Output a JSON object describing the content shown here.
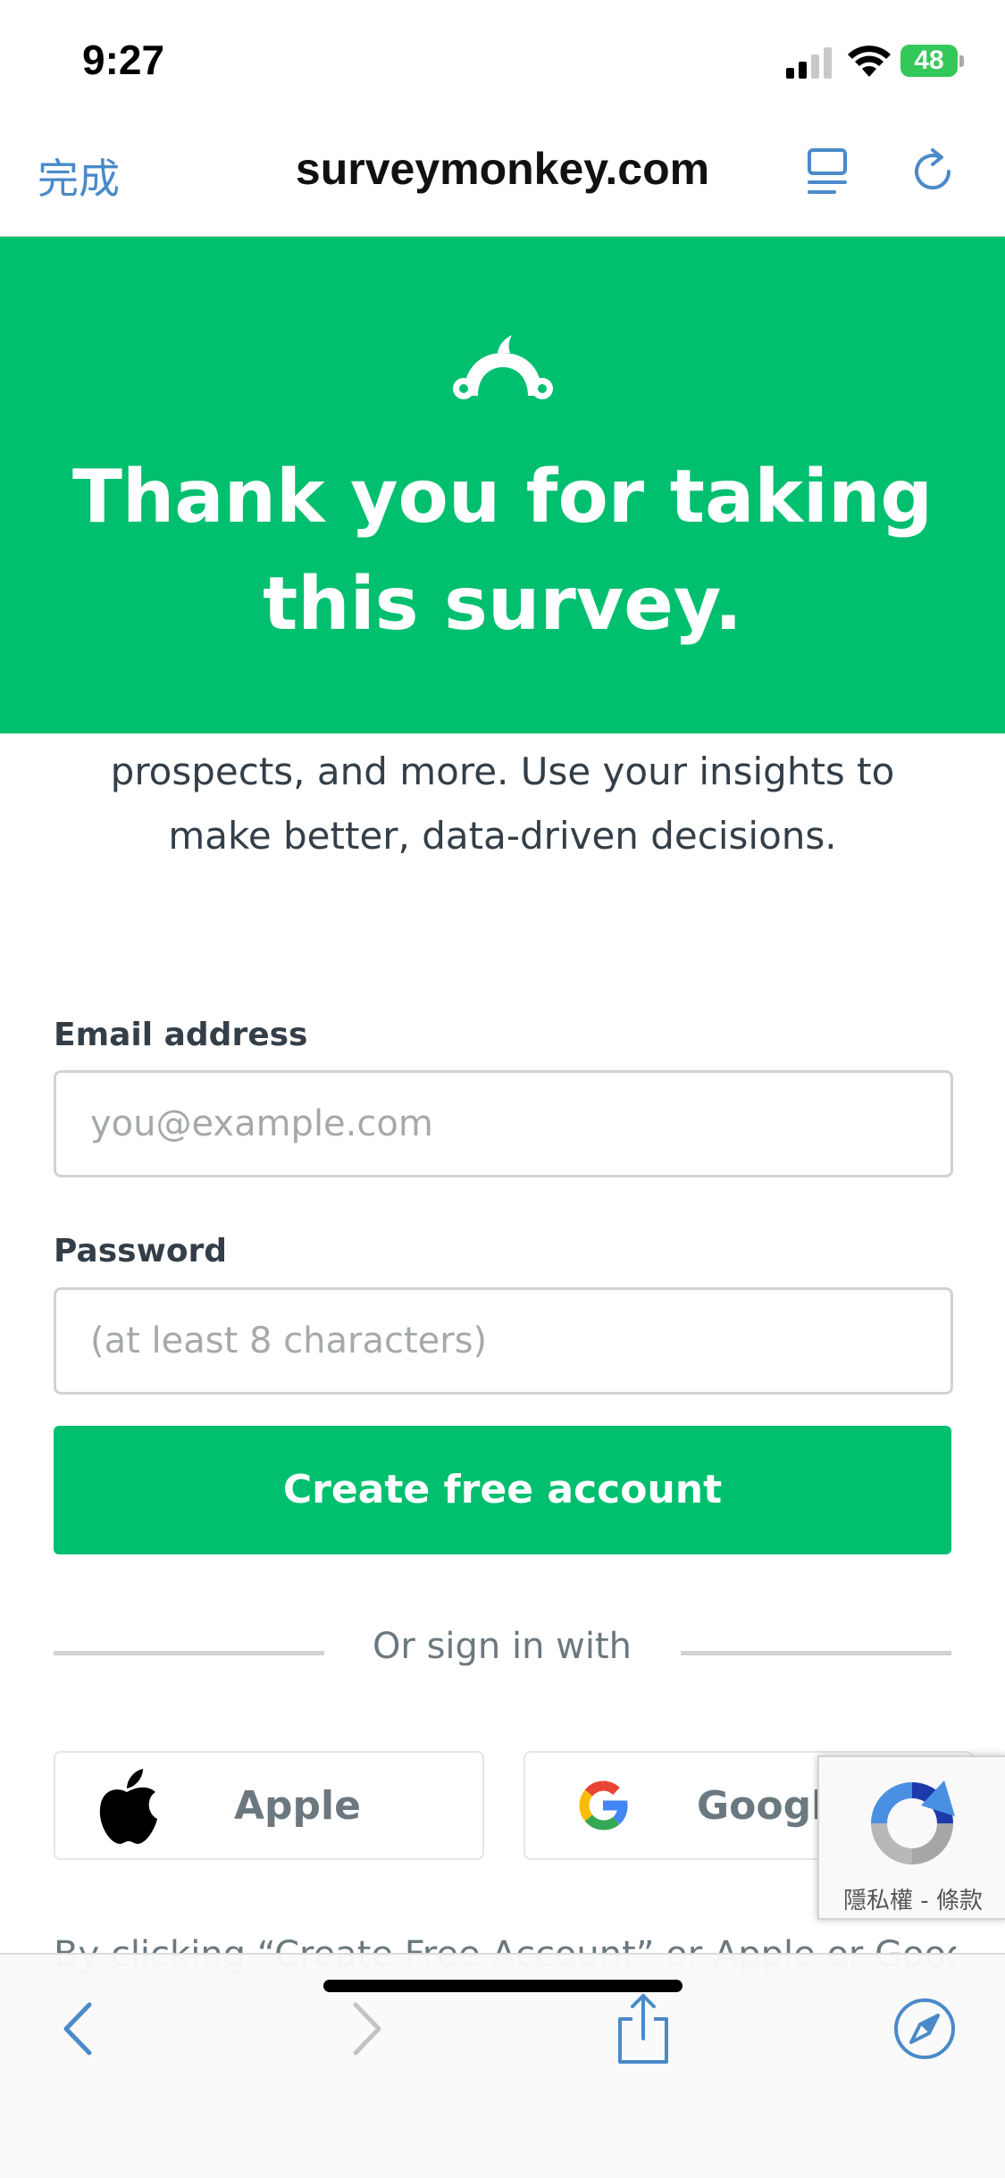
{
  "status_bar": {
    "time": "9:27",
    "battery_level": "48"
  },
  "browser": {
    "done_label": "完成",
    "url": "surveymonkey.com"
  },
  "banner": {
    "line1": "Thank you for taking",
    "line2": "this survey.",
    "color": "#00bf6f"
  },
  "intro": {
    "line1": "prospects, and more. Use your insights to",
    "line2": "make better, data-driven decisions."
  },
  "form": {
    "email_label": "Email address",
    "email_placeholder": "you@example.com",
    "password_label": "Password",
    "password_placeholder": "(at least 8 characters)",
    "submit_label": "Create free account",
    "divider_text": "Or sign in with"
  },
  "sso": {
    "apple_label": "Apple",
    "google_label": "Google"
  },
  "recaptcha": {
    "text": "隱私權 - 條款"
  },
  "terms": {
    "text": "By clicking “Create Free Account” or Apple or Google"
  }
}
